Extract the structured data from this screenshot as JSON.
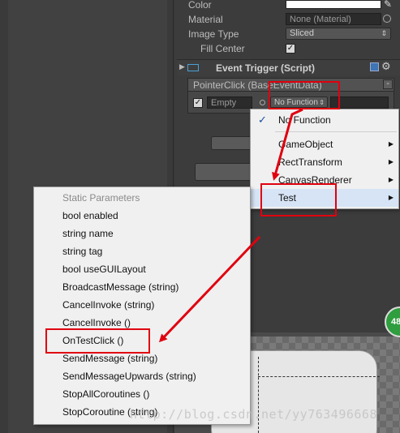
{
  "inspector": {
    "color_label": "Color",
    "material_label": "Material",
    "material_value": "None (Material)",
    "image_type_label": "Image Type",
    "image_type_value": "Sliced",
    "fill_center_label": "Fill Center",
    "fill_center_checked": "✓"
  },
  "event_trigger": {
    "title": "Event Trigger (Script)",
    "entry_header": "PointerClick (BaseEventData)",
    "runtime_value": "Empty",
    "function_value": "No Function",
    "minus_label": "-"
  },
  "function_menu": {
    "items": [
      {
        "label": "No Function",
        "check": "✓"
      },
      {
        "label": "GameObject",
        "arrow": "▶"
      },
      {
        "label": "RectTransform",
        "arrow": "▶"
      },
      {
        "label": "CanvasRenderer",
        "arrow": "▶"
      },
      {
        "label": "Test",
        "arrow": "▶"
      }
    ]
  },
  "test_menu": {
    "header": "Static Parameters",
    "items": [
      "bool enabled",
      "string name",
      "string tag",
      "bool useGUILayout",
      "BroadcastMessage (string)",
      "CancelInvoke (string)",
      "CancelInvoke ()",
      "OnTestClick ()",
      "SendMessage (string)",
      "SendMessageUpwards (string)",
      "StopAllCoroutines ()",
      "StopCoroutine (string)"
    ]
  },
  "scene": {
    "badge": "48"
  },
  "watermark": "http://blog.csdn.net/yy763496668",
  "colors": {
    "annotation_red": "#e0000f",
    "menu_bg": "#f0f0f0",
    "highlight": "#d6e4f5"
  }
}
